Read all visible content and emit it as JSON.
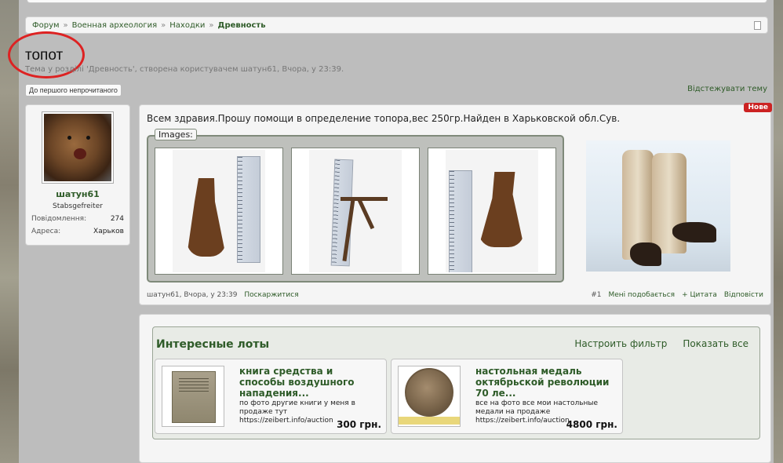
{
  "breadcrumb": {
    "items": [
      "Форум",
      "Военная археология",
      "Находки",
      "Древность"
    ],
    "separator": "»"
  },
  "thread": {
    "title": "топот",
    "subtitle": "Тема у розділі 'Древность', створена користувачем шатун61, Вчора, у 23:39.",
    "first_unread_button": "До першого непрочитаного",
    "watch_link": "Відстежувати тему"
  },
  "user": {
    "name": "шатун61",
    "rank": "Stabsgefreiter",
    "stats": [
      {
        "key": "Повідомлення:",
        "value": "274"
      },
      {
        "key": "Адреса:",
        "value": "Харьков"
      }
    ]
  },
  "post": {
    "badge": "Нове",
    "text": "Всем здравия.Прошу помощи в определение топора,вес 250гр.Найден в Харьковской обл.Сув.",
    "images_label": "Images:",
    "meta_author_time": "шатун61, Вчора, у 23:39",
    "complain": "Поскаржитися",
    "post_number": "#1",
    "like": "Мені подобається",
    "quote": "+ Цитата",
    "reply": "Відповісти"
  },
  "lots": {
    "title": "Интересные лоты",
    "filter_link": "Настроить фильтр",
    "show_all_link": "Показать все",
    "items": [
      {
        "name": "книга средства и способы воздушного нападения...",
        "desc": "по фото другие книги у меня в продаже тут https://zeibert.info/auction",
        "price": "300 грн."
      },
      {
        "name": "настольная медаль октябрьской революции 70 ле...",
        "desc": "все на фото все мои настольные медали на продаже https://zeibert.info/auction",
        "price": "4800 грн."
      }
    ]
  },
  "colors": {
    "link_green": "#2e5b28",
    "badge_red": "#cc2222",
    "highlight_circle": "#dd2222"
  }
}
